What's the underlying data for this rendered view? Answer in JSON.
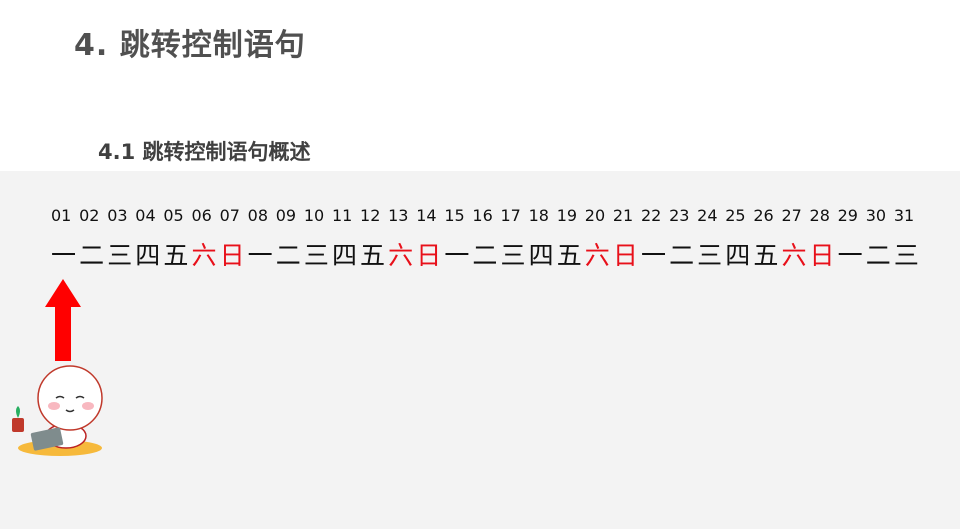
{
  "slide": {
    "title": "4. 跳转控制语句",
    "subtitle": "4.1 跳转控制语句概述"
  },
  "calendar": {
    "dates": [
      "01",
      "02",
      "03",
      "04",
      "05",
      "06",
      "07",
      "08",
      "09",
      "10",
      "11",
      "12",
      "13",
      "14",
      "15",
      "16",
      "17",
      "18",
      "19",
      "20",
      "21",
      "22",
      "23",
      "24",
      "25",
      "26",
      "27",
      "28",
      "29",
      "30",
      "31"
    ],
    "weekdays": [
      "一",
      "二",
      "三",
      "四",
      "五",
      "六",
      "日",
      "一",
      "二",
      "三",
      "四",
      "五",
      "六",
      "日",
      "一",
      "二",
      "三",
      "四",
      "五",
      "六",
      "日",
      "一",
      "二",
      "三",
      "四",
      "五",
      "六",
      "日",
      "一",
      "二",
      "三"
    ],
    "weekend_color": "#e8101a",
    "text_color": "#111111"
  },
  "icons": {
    "arrow": "up-arrow-icon",
    "mascot": "mascot-laptop-icon"
  },
  "colors": {
    "arrow": "#ff0000",
    "panel_bg": "#f3f3f3"
  }
}
